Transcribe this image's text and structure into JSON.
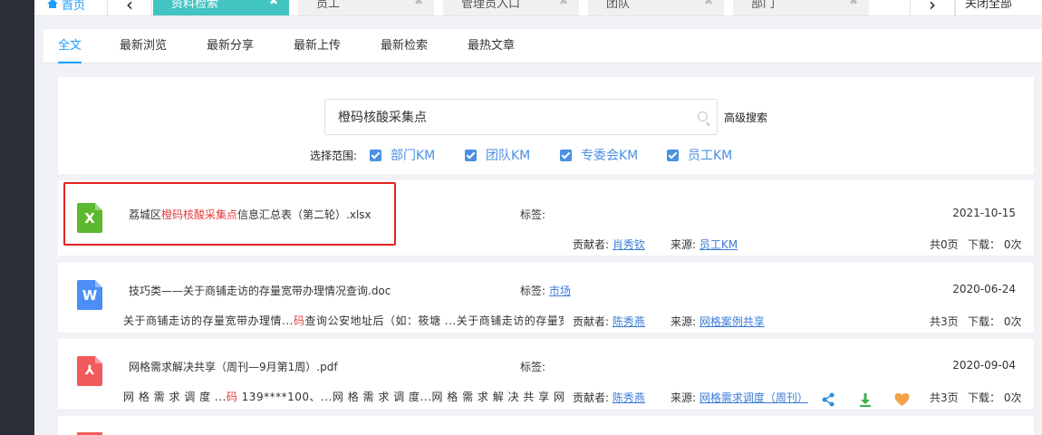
{
  "tabs": {
    "home": "首页",
    "prev": "‹",
    "next": "›",
    "items": [
      {
        "label": "资料检索",
        "active": true
      },
      {
        "label": "员工",
        "active": false
      },
      {
        "label": "管理员入口",
        "active": false
      },
      {
        "label": "团队",
        "active": false
      },
      {
        "label": "部门",
        "active": false
      }
    ],
    "close": "✖",
    "close_all": "关闭全部"
  },
  "subtabs": [
    "全文",
    "最新浏览",
    "最新分享",
    "最新上传",
    "最新检索",
    "最热文章"
  ],
  "search": {
    "value": "橙码核酸采集点",
    "advanced": "高级搜索",
    "scope_label": "选择范围:",
    "scopes": [
      "部门KM",
      "团队KM",
      "专委会KM",
      "员工KM"
    ]
  },
  "results": [
    {
      "icon": "xlsx-file-icon",
      "name_pre": "荔城区",
      "name_hl": "橙码核酸采集点",
      "name_post": "信息汇总表（第二轮）.xlsx",
      "tags_label": "标签:",
      "tag": "",
      "date": "2021-10-15",
      "snippet_pre": "",
      "snippet_hl": "",
      "snippet_post": "",
      "contributor_label": "贡献者:",
      "contributor": "肖秀钦",
      "source_label": "来源:",
      "source": "员工KM",
      "pages": "共0页",
      "downloads": "下载：  0次"
    },
    {
      "icon": "doc-file-icon",
      "name_pre": "技巧类——关于商铺走访的存量宽带办理情况查询.doc",
      "name_hl": "",
      "name_post": "",
      "tags_label": "标签:",
      "tag": "市场",
      "date": "2020-06-24",
      "snippet_pre": "关于商铺走访的存量宽带办理情...",
      "snippet_hl": "码",
      "snippet_post": "查询公安地址后（如：筱塘 ...关于商铺走访的存量宽带...",
      "contributor_label": "贡献者:",
      "contributor": "陈秀燕",
      "source_label": "来源:",
      "source": "网格案例共享",
      "pages": "共3页",
      "downloads": "下载：  0次"
    },
    {
      "icon": "pdf-file-icon",
      "name_pre": "网格需求解决共享（周刊—9月第1周）.pdf",
      "name_hl": "",
      "name_post": "",
      "tags_label": "标签:",
      "tag": "",
      "date": "2020-09-04",
      "snippet_pre": "网 格 需 求 调 度 ...",
      "snippet_hl": "码",
      "snippet_post": " 139****100、...网 格 需 求 调 度...网 格 需 求 解 决 共 享 网 格 ...",
      "contributor_label": "贡献者:",
      "contributor": "陈秀燕",
      "source_label": "来源:",
      "source": "网格需求调度（周刊）",
      "pages": "共3页",
      "downloads": "下载：  0次"
    }
  ],
  "colors": {
    "accent": "#1a9fff",
    "active_tab": "#41c4c2",
    "highlight": "#e63b3b",
    "xlsx": "#5cb82e",
    "doc": "#4c8df6",
    "pdf": "#f25b5b"
  }
}
